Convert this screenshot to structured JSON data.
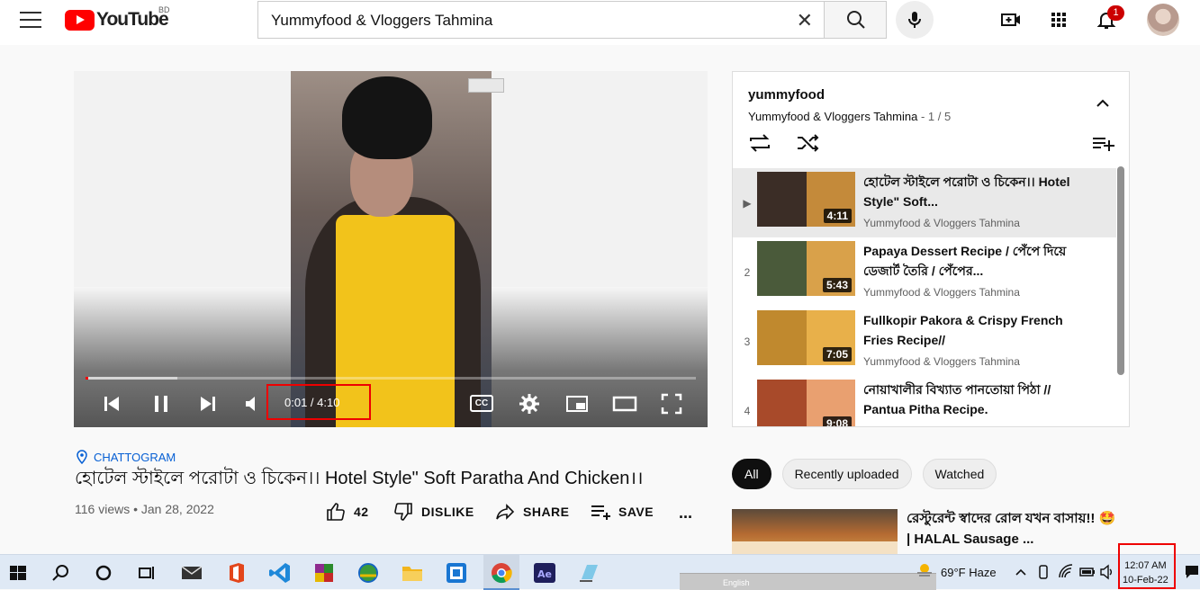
{
  "header": {
    "logo_text": "YouTube",
    "country_code": "BD",
    "search_value": "Yummyfood & Vloggers Tahmina",
    "notification_count": "1"
  },
  "player": {
    "time_display": "0:01 / 4:10",
    "progress_fraction": 0.004,
    "buffered_fraction": 0.15,
    "cc_label": "CC"
  },
  "video": {
    "location": "CHATTOGRAM",
    "title": "হোটেল স্টাইলে পরোটা ও চিকেন।। Hotel Style\" Soft Paratha And Chicken।।",
    "views_date": "116 views • Jan 28, 2022",
    "like_count": "42",
    "dislike_label": "DISLIKE",
    "share_label": "SHARE",
    "save_label": "SAVE",
    "more_label": "..."
  },
  "playlist": {
    "name": "yummyfood",
    "channel": "Yummyfood & Vloggers Tahmina",
    "position": " - 1 / 5",
    "items": [
      {
        "index": "▶",
        "title": "হোটেল স্টাইলে পরোটা ও চিকেন।। Hotel Style\" Soft...",
        "channel": "Yummyfood & Vloggers Tahmina",
        "duration": "4:11",
        "active": true
      },
      {
        "index": "2",
        "title": "Papaya Dessert Recipe / পেঁপে দিয়ে ডেজার্ট তৈরি / পেঁপের...",
        "channel": "Yummyfood & Vloggers Tahmina",
        "duration": "5:43",
        "active": false
      },
      {
        "index": "3",
        "title": "Fullkopir Pakora & Crispy French Fries Recipe//",
        "channel": "Yummyfood & Vloggers Tahmina",
        "duration": "7:05",
        "active": false
      },
      {
        "index": "4",
        "title": "নোয়াখালীর বিখ্যাত পানতোয়া পিঠা // Pantua Pitha Recipe.",
        "channel": "Yummyfood & Vloggers Tahmina",
        "duration": "9:08",
        "active": false
      }
    ]
  },
  "chips": [
    "All",
    "Recently uploaded",
    "Watched"
  ],
  "recommendation": {
    "title": "রেস্টুরেন্ট স্বাদের রোল যখন বাসায়!! 🤩 | HALAL Sausage ..."
  },
  "taskbar": {
    "language": "English",
    "weather": "69°F  Haze",
    "time": "12:07 AM",
    "date": "10-Feb-22"
  },
  "colors": {
    "brand_red": "#ff0000",
    "link_blue": "#065fd4",
    "highlight_box": "#e00000"
  }
}
